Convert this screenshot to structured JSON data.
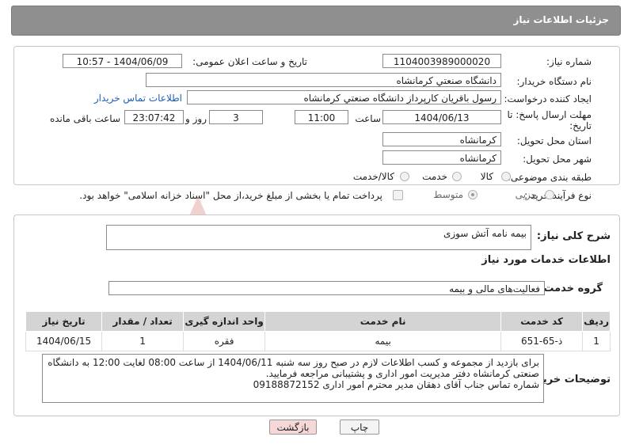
{
  "header": {
    "title": "جزئیات اطلاعات نیاز"
  },
  "form": {
    "need_number_label": "شماره نیاز:",
    "need_number": "1104003989000020",
    "announce_label": "تاریخ و ساعت اعلان عمومی:",
    "announce_value": "1404/06/09 - 10:57",
    "buyer_org_label": "نام دستگاه خریدار:",
    "buyer_org": "دانشگاه صنعتي كرمانشاه",
    "creator_label": "ایجاد کننده درخواست:",
    "creator": "رسول باقریان کارپرداز دانشگاه صنعتي كرمانشاه",
    "contact_link": "اطلاعات تماس خریدار",
    "deadline_label_1": "مهلت ارسال پاسخ: تا",
    "deadline_label_2": "تاریخ:",
    "deadline_date": "1404/06/13",
    "time_label": "ساعت",
    "deadline_time": "11:00",
    "days_value": "3",
    "days_label": "روز و",
    "remaining_value": "23:07:42",
    "remaining_label": "ساعت باقی مانده",
    "province_label": "استان محل تحویل:",
    "province": "کرمانشاه",
    "city_label": "شهر محل تحویل:",
    "city": "کرمانشاه",
    "category_label": "طبقه بندی موضوعی:",
    "category_options": [
      "کالا",
      "خدمت",
      "کالا/خدمت"
    ],
    "process_label": "نوع فرآیند خرید :",
    "process_options": [
      "جزیی",
      "متوسط"
    ],
    "payment_note": "پرداخت تمام یا بخشی از مبلغ خرید،از محل \"اسناد خزانه اسلامی\" خواهد بود."
  },
  "summary": {
    "label": "شرح کلی نیاز:",
    "value": "بیمه نامه آتش سوزی"
  },
  "services": {
    "section_title": "اطلاعات خدمات مورد نیاز",
    "group_label": "گروه خدمت:",
    "group_value": "فعالیت‌های مالی و بیمه",
    "columns": [
      "ردیف",
      "کد خدمت",
      "نام خدمت",
      "واحد اندازه گیری",
      "تعداد / مقدار",
      "تاریخ نیاز"
    ],
    "rows": [
      {
        "index": "1",
        "code": "ذ-65-651",
        "name": "بیمه",
        "unit": "فقره",
        "qty": "1",
        "date": "1404/06/15"
      }
    ]
  },
  "notes": {
    "label": "توضیحات خریدار:",
    "line1": "برای بازدید از مجموعه و کسب اطلاعات لازم در صبح روز سه شنبه 1404/06/11 از ساعت 08:00 لغایت 12:00 به دانشگاه",
    "line2": "صنعتی کرمانشاه دفتر مدیریت امور اداری و پشتیبانی مراجعه فرمایید.",
    "line3": "شماره تماس جناب آقای دهقان مدیر محترم امور اداری  09188872152"
  },
  "buttons": {
    "print": "چاپ",
    "back": "بازگشت"
  },
  "colors": {
    "header_bg": "#8f8f8f",
    "back_bg": "#f7d8d8",
    "table_head": "#d4d4d4",
    "link": "#1f5fb0"
  }
}
